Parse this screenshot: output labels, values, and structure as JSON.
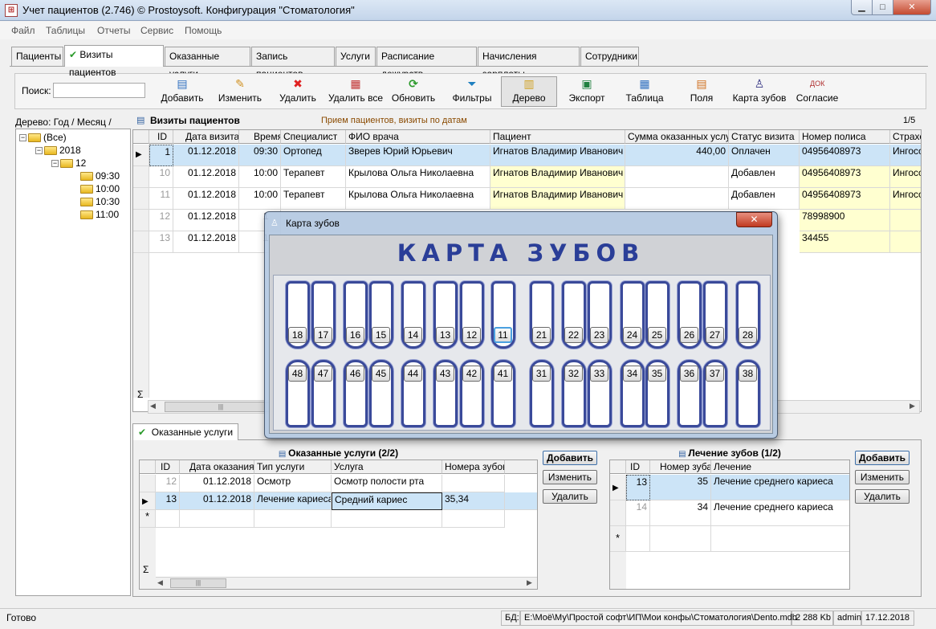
{
  "window": {
    "title": "Учет пациентов (2.746) © Prostoysoft. Конфигурация \"Стоматология\""
  },
  "menu": [
    "Файл",
    "Таблицы",
    "Отчеты",
    "Сервис",
    "Помощь"
  ],
  "tabs": [
    {
      "label": "Пациенты"
    },
    {
      "label": "Визиты пациентов",
      "check": "✔"
    },
    {
      "label": "Оказанные услуги"
    },
    {
      "label": "Запись пациентов"
    },
    {
      "label": "Услуги"
    },
    {
      "label": "Расписание дежурств"
    },
    {
      "label": "Начисления зарплаты"
    },
    {
      "label": "Сотрудники"
    }
  ],
  "search": {
    "label": "Поиск:",
    "value": ""
  },
  "toolbar": [
    {
      "label": "Добавить",
      "icon": "add-document-icon"
    },
    {
      "label": "Изменить",
      "icon": "pencil-icon"
    },
    {
      "label": "Удалить",
      "icon": "red-x-icon"
    },
    {
      "label": "Удалить все",
      "icon": "delete-all-icon"
    },
    {
      "label": "Обновить",
      "icon": "refresh-icon"
    },
    {
      "label": "Фильтры",
      "icon": "funnel-icon"
    },
    {
      "label": "Дерево",
      "icon": "tree-icon"
    },
    {
      "label": "Экспорт",
      "icon": "excel-export-icon"
    },
    {
      "label": "Таблица",
      "icon": "table-icon"
    },
    {
      "label": "Поля",
      "icon": "fields-icon"
    },
    {
      "label": "Карта зубов",
      "icon": "tooth-icon"
    },
    {
      "label": "Согласие",
      "icon": "document-icon"
    }
  ],
  "tree": {
    "label": "Дерево: Год / Месяц /",
    "nodes": [
      "(Все)",
      "2018",
      "12",
      "09:30",
      "10:00",
      "10:30",
      "11:00"
    ]
  },
  "grid": {
    "title": "Визиты пациентов",
    "subtitle": "Прием пациентов, визиты по датам",
    "page": "1/5",
    "columns": [
      "ID",
      "Дата визита",
      "Время",
      "Специалист",
      "ФИО врача",
      "Пациент",
      "Сумма оказанных услуг",
      "Статус визита",
      "Номер полиса",
      "Страхо"
    ],
    "rows": [
      [
        "1",
        "01.12.2018",
        "09:30",
        "Ортопед",
        "Зверев Юрий Юрьевич",
        "Игнатов Владимир Иванович",
        "440,00",
        "Оплачен",
        "04956408973",
        "Ингосс"
      ],
      [
        "10",
        "01.12.2018",
        "10:00",
        "Терапевт",
        "Крылова Ольга Николаевна",
        "Игнатов Владимир Иванович",
        "",
        "Добавлен",
        "04956408973",
        "Ингосс"
      ],
      [
        "11",
        "01.12.2018",
        "10:00",
        "Терапевт",
        "Крылова Ольга Николаевна",
        "Игнатов Владимир Иванович",
        "",
        "Добавлен",
        "04956408973",
        "Ингосс"
      ],
      [
        "12",
        "01.12.2018",
        "1",
        "",
        "",
        "",
        "",
        "",
        "78998900",
        ""
      ],
      [
        "13",
        "01.12.2018",
        "1",
        "",
        "",
        "",
        "",
        "",
        "34455",
        ""
      ]
    ],
    "sigma": "Σ"
  },
  "bottom_tab": {
    "label": "Оказанные услуги",
    "check": "✔"
  },
  "services": {
    "title": "Оказанные услуги (2/2)",
    "columns": [
      "ID",
      "Дата оказания",
      "Тип услуги",
      "Услуга",
      "Номера зубов"
    ],
    "rows": [
      [
        "12",
        "01.12.2018",
        "Осмотр",
        "Осмотр полости рта",
        ""
      ],
      [
        "13",
        "01.12.2018",
        "Лечение кариеса",
        "Средний кариес",
        "35,34"
      ]
    ],
    "buttons": [
      "Добавить",
      "Изменить",
      "Удалить"
    ],
    "new_row": "*",
    "sigma": "Σ"
  },
  "treatment": {
    "title": "Лечение зубов (1/2)",
    "columns": [
      "ID",
      "Номер зуба",
      "Лечение"
    ],
    "rows": [
      [
        "13",
        "35",
        "Лечение среднего кариеса"
      ],
      [
        "14",
        "34",
        "Лечение среднего кариеса"
      ]
    ],
    "buttons": [
      "Добавить",
      "Изменить",
      "Удалить"
    ],
    "new_row": "*"
  },
  "dental_chart": {
    "title": "Карта зубов",
    "heading": "КАРТА ЗУБОВ",
    "upper": [
      "18",
      "17",
      "16",
      "15",
      "14",
      "13",
      "12",
      "11",
      "21",
      "22",
      "23",
      "24",
      "25",
      "26",
      "27",
      "28"
    ],
    "lower": [
      "48",
      "47",
      "46",
      "45",
      "44",
      "43",
      "42",
      "41",
      "31",
      "32",
      "33",
      "34",
      "35",
      "36",
      "37",
      "38"
    ],
    "selected": "11"
  },
  "status": {
    "text": "Готово",
    "db_label": "БД:",
    "db_path": "E:\\Моё\\Му\\Простой софт\\ИП\\Мои конфы\\Стоматология\\Dento.mdb",
    "db_size": "2 288 Kb",
    "user": "admin",
    "date": "17.12.2018"
  }
}
